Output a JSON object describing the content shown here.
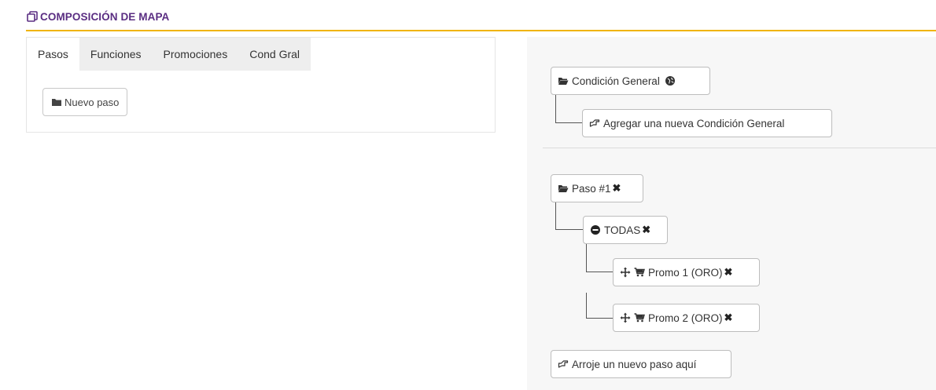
{
  "header": {
    "title": "COMPOSICIÓN DE MAPA",
    "icon": "copy-icon",
    "accent": "#5a2d82",
    "rule_color": "#f0b400"
  },
  "left_panel": {
    "tabs": [
      {
        "label": "Pasos",
        "active": true
      },
      {
        "label": "Funciones",
        "active": false
      },
      {
        "label": "Promociones",
        "active": false
      },
      {
        "label": "Cond Gral",
        "active": false
      }
    ],
    "new_step_button": {
      "label": "Nuevo paso",
      "icon": "folder-icon"
    }
  },
  "tree": {
    "general_condition": {
      "label": "Condición General",
      "icon": "folder-open-icon",
      "badge_icon": "globe-icon"
    },
    "add_general_condition": {
      "label": "Agregar una nueva Condición General",
      "icon": "hand-point-right-icon"
    },
    "step1": {
      "label": "Paso #1",
      "icon": "folder-open-icon",
      "remove": "✖"
    },
    "all_condition": {
      "label": "TODAS",
      "icon": "minus-circle-icon",
      "remove": "✖"
    },
    "promos": [
      {
        "label": "Promo 1 (ORO)",
        "remove": "✖",
        "icons": [
          "move-icon",
          "cart-icon"
        ]
      },
      {
        "label": "Promo 2 (ORO)",
        "remove": "✖",
        "icons": [
          "move-icon",
          "cart-icon"
        ]
      }
    ],
    "drop_step": {
      "label": "Arroje un nuevo paso aquí",
      "icon": "hand-point-right-icon"
    }
  }
}
